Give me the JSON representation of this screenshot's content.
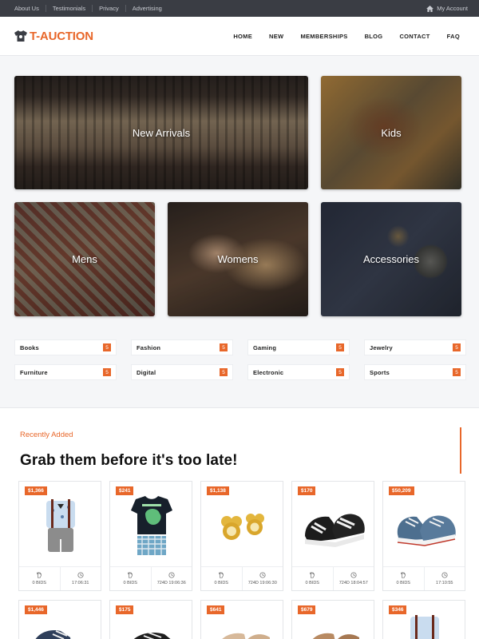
{
  "topbar": {
    "links": [
      "About Us",
      "Testimonials",
      "Privacy",
      "Advertising"
    ],
    "account": "My Account"
  },
  "header": {
    "logo_text": "T-AUCTION",
    "nav": [
      "HOME",
      "NEW",
      "MEMBERSHIPS",
      "BLOG",
      "CONTACT",
      "FAQ"
    ]
  },
  "tiles": [
    {
      "label": "New Arrivals"
    },
    {
      "label": "Kids"
    },
    {
      "label": "Mens"
    },
    {
      "label": "Womens"
    },
    {
      "label": "Accessories"
    }
  ],
  "categories": [
    {
      "name": "Books",
      "count": "5"
    },
    {
      "name": "Fashion",
      "count": "5"
    },
    {
      "name": "Gaming",
      "count": "5"
    },
    {
      "name": "Jewelry",
      "count": "5"
    },
    {
      "name": "Furniture",
      "count": "5"
    },
    {
      "name": "Digital",
      "count": "5"
    },
    {
      "name": "Electronic",
      "count": "5"
    },
    {
      "name": "Sports",
      "count": "5"
    }
  ],
  "recent": {
    "eyebrow": "Recently Added",
    "headline": "Grab them before it's too late!",
    "cards": [
      {
        "price": "$1,366",
        "bids": "0 BIDS",
        "time": "17:06:31",
        "item": "baby-outfit"
      },
      {
        "price": "$241",
        "bids": "0 BIDS",
        "time": "724D 19:06:36",
        "item": "dino-tshirt"
      },
      {
        "price": "$1,138",
        "bids": "0 BIDS",
        "time": "724D 19:06:30",
        "item": "earrings"
      },
      {
        "price": "$170",
        "bids": "0 BIDS",
        "time": "724D 18:04:57",
        "item": "baby-sneakers"
      },
      {
        "price": "$50,209",
        "bids": "0 BIDS",
        "time": "17:10:55",
        "item": "denim-sneakers"
      }
    ],
    "cards_row2": [
      {
        "price": "$1,446"
      },
      {
        "price": "$175"
      },
      {
        "price": "$641"
      },
      {
        "price": "$679"
      },
      {
        "price": "$346"
      }
    ]
  },
  "colors": {
    "accent": "#e8672a",
    "topbar": "#3a3d44"
  }
}
